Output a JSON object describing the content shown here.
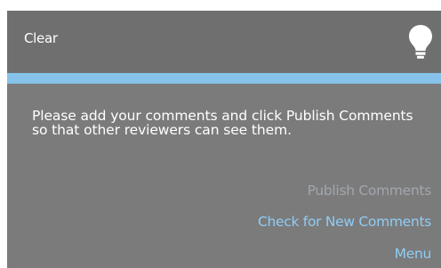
{
  "header": {
    "clear_label": "Clear",
    "icon": "lightbulb-icon"
  },
  "colors": {
    "panel": "#7b7b7b",
    "header": "#6f6f6f",
    "accent_bar": "#86c2ea",
    "link": "#8fcdf5",
    "link_disabled": "#a2a7ad"
  },
  "body": {
    "message": "Please add your comments and click Publish Comments so that other reviewers can see them."
  },
  "links": {
    "publish_comments": "Publish Comments",
    "check_new_comments": "Check for New Comments",
    "menu": "Menu"
  }
}
